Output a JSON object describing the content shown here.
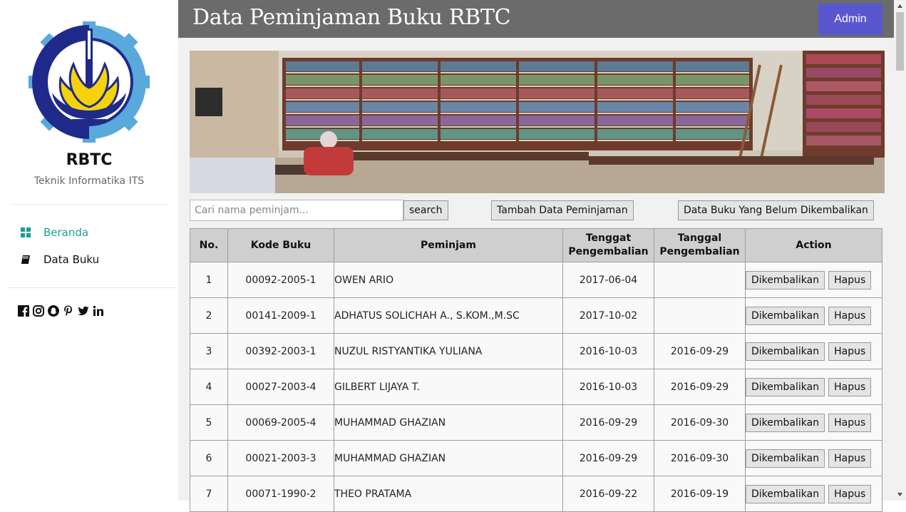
{
  "sidebar": {
    "brand": "RBTC",
    "subtitle": "Teknik Informatika ITS",
    "nav": [
      {
        "label": "Beranda",
        "icon": "grid-icon",
        "active": true
      },
      {
        "label": "Data Buku",
        "icon": "book-icon",
        "active": false
      }
    ],
    "socials": [
      "facebook-icon",
      "instagram-icon",
      "snapchat-icon",
      "pinterest-icon",
      "twitter-icon",
      "linkedin-icon"
    ]
  },
  "header": {
    "title": "Data Peminjaman Buku RBTC",
    "admin_label": "Admin"
  },
  "toolbar": {
    "search_placeholder": "Cari nama peminjam...",
    "search_label": "search",
    "add_label": "Tambah Data Peminjaman",
    "unreturned_label": "Data Buku Yang Belum Dikembalikan"
  },
  "table": {
    "headers": [
      "No.",
      "Kode Buku",
      "Peminjam",
      "Tenggat Pengembalian",
      "Tanggal Pengembalian",
      "Action"
    ],
    "rows": [
      {
        "no": "1",
        "kode": "00092-2005-1",
        "peminjam": "OWEN ARIO",
        "tenggat": "2017-06-04",
        "tanggal": ""
      },
      {
        "no": "2",
        "kode": "00141-2009-1",
        "peminjam": "ADHATUS SOLICHAH A., S.KOM.,M.SC",
        "tenggat": "2017-10-02",
        "tanggal": ""
      },
      {
        "no": "3",
        "kode": "00392-2003-1",
        "peminjam": "NUZUL RISTYANTIKA YULIANA",
        "tenggat": "2016-10-03",
        "tanggal": "2016-09-29"
      },
      {
        "no": "4",
        "kode": "00027-2003-4",
        "peminjam": "GILBERT LIJAYA T.",
        "tenggat": "2016-10-03",
        "tanggal": "2016-09-29"
      },
      {
        "no": "5",
        "kode": "00069-2005-4",
        "peminjam": "MUHAMMAD GHAZIAN",
        "tenggat": "2016-09-29",
        "tanggal": "2016-09-30"
      },
      {
        "no": "6",
        "kode": "00021-2003-3",
        "peminjam": "MUHAMMAD GHAZIAN",
        "tenggat": "2016-09-29",
        "tanggal": "2016-09-30"
      },
      {
        "no": "7",
        "kode": "00071-1990-2",
        "peminjam": "THEO PRATAMA",
        "tenggat": "2016-09-22",
        "tanggal": "2016-09-19"
      }
    ],
    "return_label": "Dikembalikan",
    "delete_label": "Hapus"
  },
  "colors": {
    "accent": "#1a9e95",
    "header_bg": "#6b6b6b",
    "admin_bg": "#5957cf"
  }
}
